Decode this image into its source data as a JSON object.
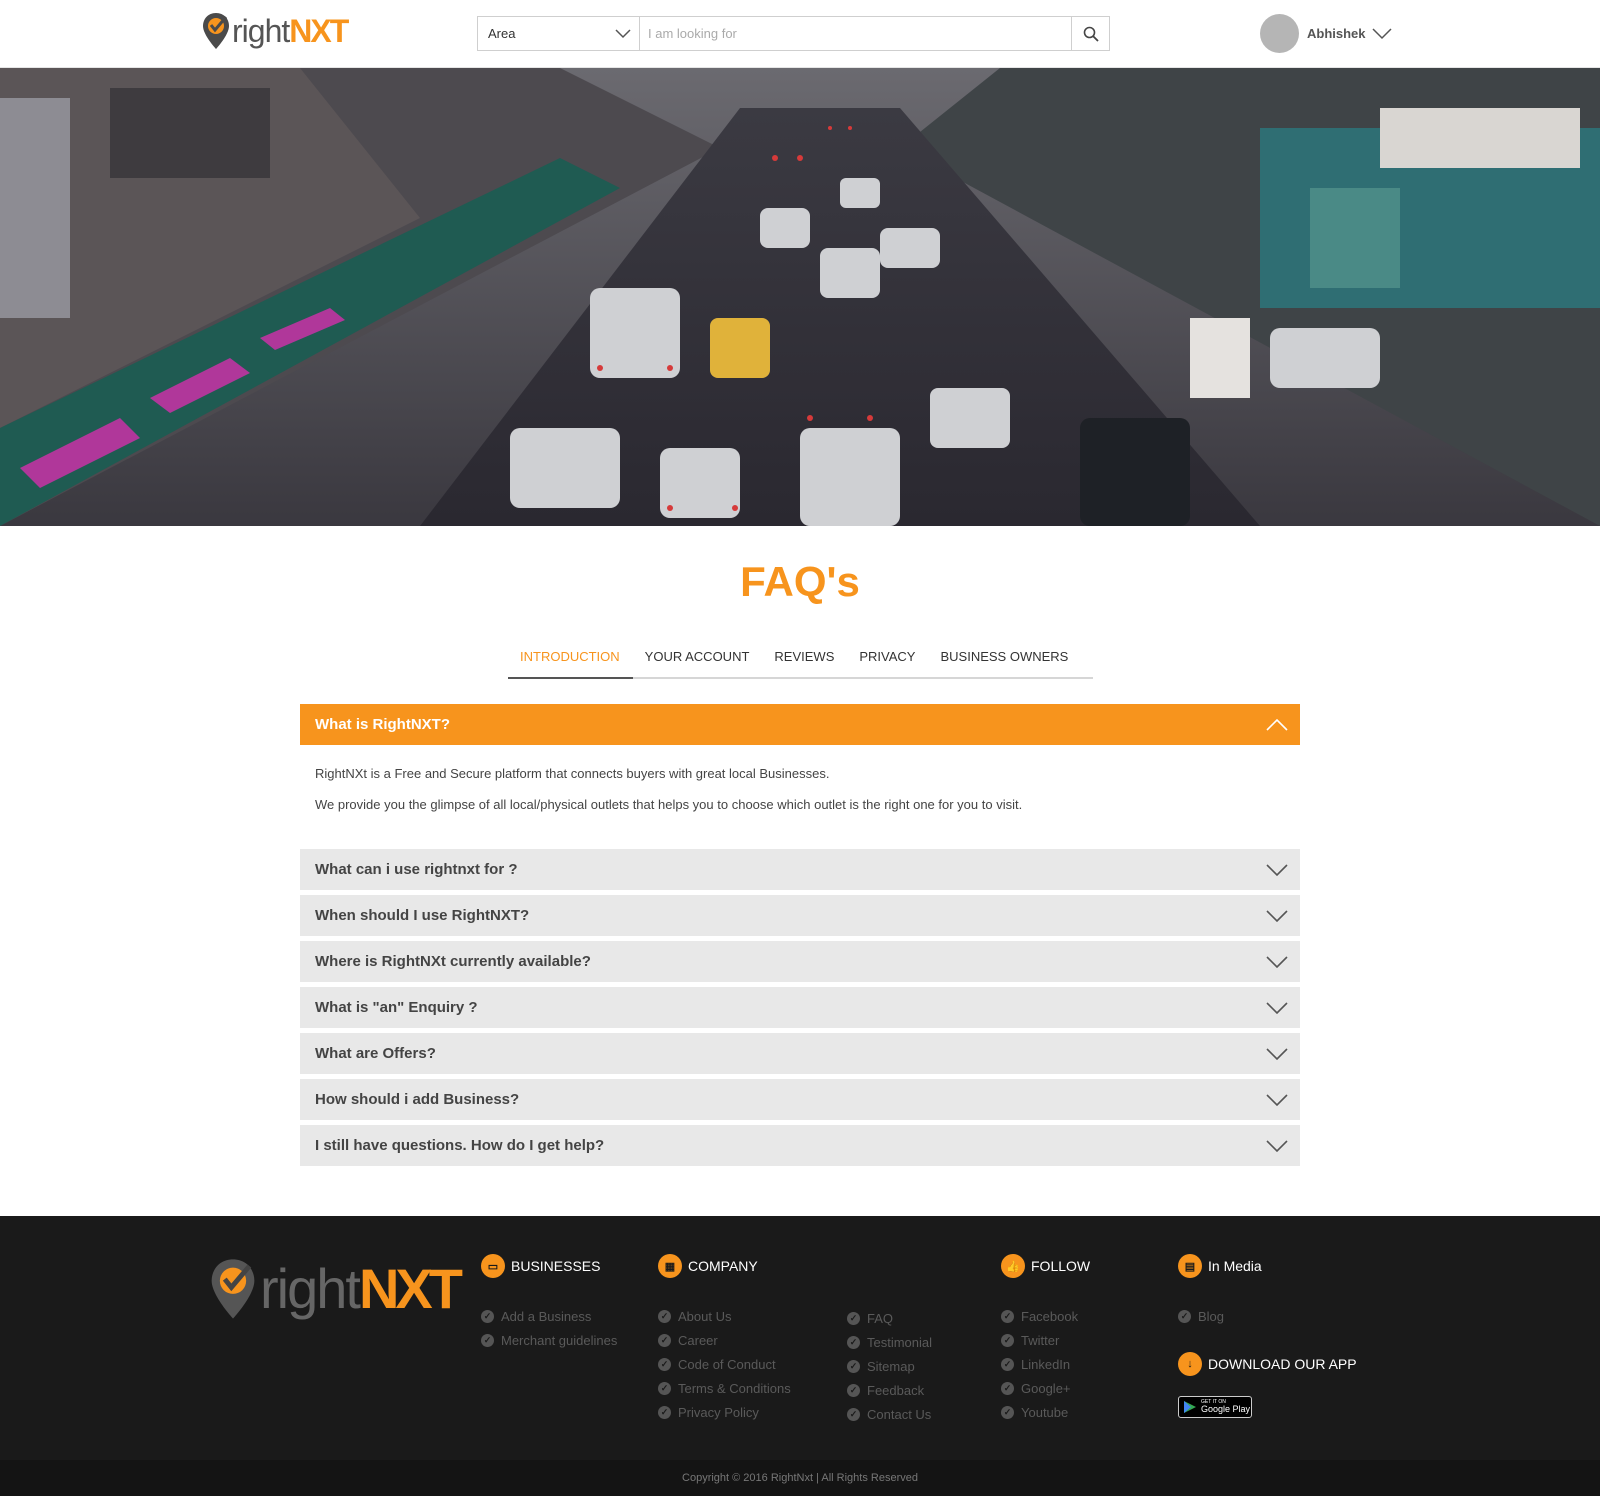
{
  "header": {
    "logo": {
      "text_light": "right",
      "text_bold": "NXT"
    },
    "search": {
      "area_label": "Area",
      "placeholder": "I am looking for",
      "search_icon": "search-icon"
    },
    "user": {
      "name": "Abhishek"
    }
  },
  "hero": {
    "image_subject": "busy city street traffic photo"
  },
  "faq": {
    "title": "FAQ's",
    "tabs": [
      {
        "label": "INTRODUCTION",
        "active": true
      },
      {
        "label": "YOUR ACCOUNT",
        "active": false
      },
      {
        "label": "REVIEWS",
        "active": false
      },
      {
        "label": "PRIVACY",
        "active": false
      },
      {
        "label": "BUSINESS OWNERS",
        "active": false
      }
    ],
    "open_item": {
      "question": "What is RightNXT?",
      "answers": [
        "RightNXt is a Free and Secure platform that connects buyers with great local Businesses.",
        "We provide you the glimpse of all local/physical outlets that helps you to choose which outlet is the right one for you to visit."
      ]
    },
    "items": [
      "What can i use rightnxt for ?",
      "When should I use RightNXT?",
      "Where is RightNXt currently available?",
      "What is \"an\" Enquiry ?",
      "What are Offers?",
      "How should i add Business?",
      "I still have questions. How do I get help?"
    ]
  },
  "footer": {
    "logo": {
      "text_light": "right",
      "text_bold": "NXT"
    },
    "businesses": {
      "heading": "BUSINESSES",
      "links": [
        "Add a Business",
        "Merchant guidelines"
      ]
    },
    "company": {
      "heading": "COMPANY",
      "links_a": [
        "About Us",
        "Career",
        "Code of Conduct",
        "Terms & Conditions",
        "Privacy Policy"
      ],
      "links_b": [
        "FAQ",
        "Testimonial",
        "Sitemap",
        "Feedback",
        "Contact Us"
      ]
    },
    "follow": {
      "heading": "FOLLOW",
      "links": [
        "Facebook",
        "Twitter",
        "LinkedIn",
        "Google+",
        "Youtube"
      ]
    },
    "media": {
      "heading": "In Media",
      "links": [
        "Blog"
      ]
    },
    "app": {
      "heading": "DOWNLOAD OUR APP",
      "badge_small": "GET IT ON",
      "badge_big": "Google Play"
    },
    "copyright": "Copyright © 2016 RightNxt | All Rights Reserved"
  },
  "colors": {
    "accent": "#f7941d",
    "footer_bg": "#1a1a1a",
    "closed_item_bg": "#e8e8e8"
  }
}
